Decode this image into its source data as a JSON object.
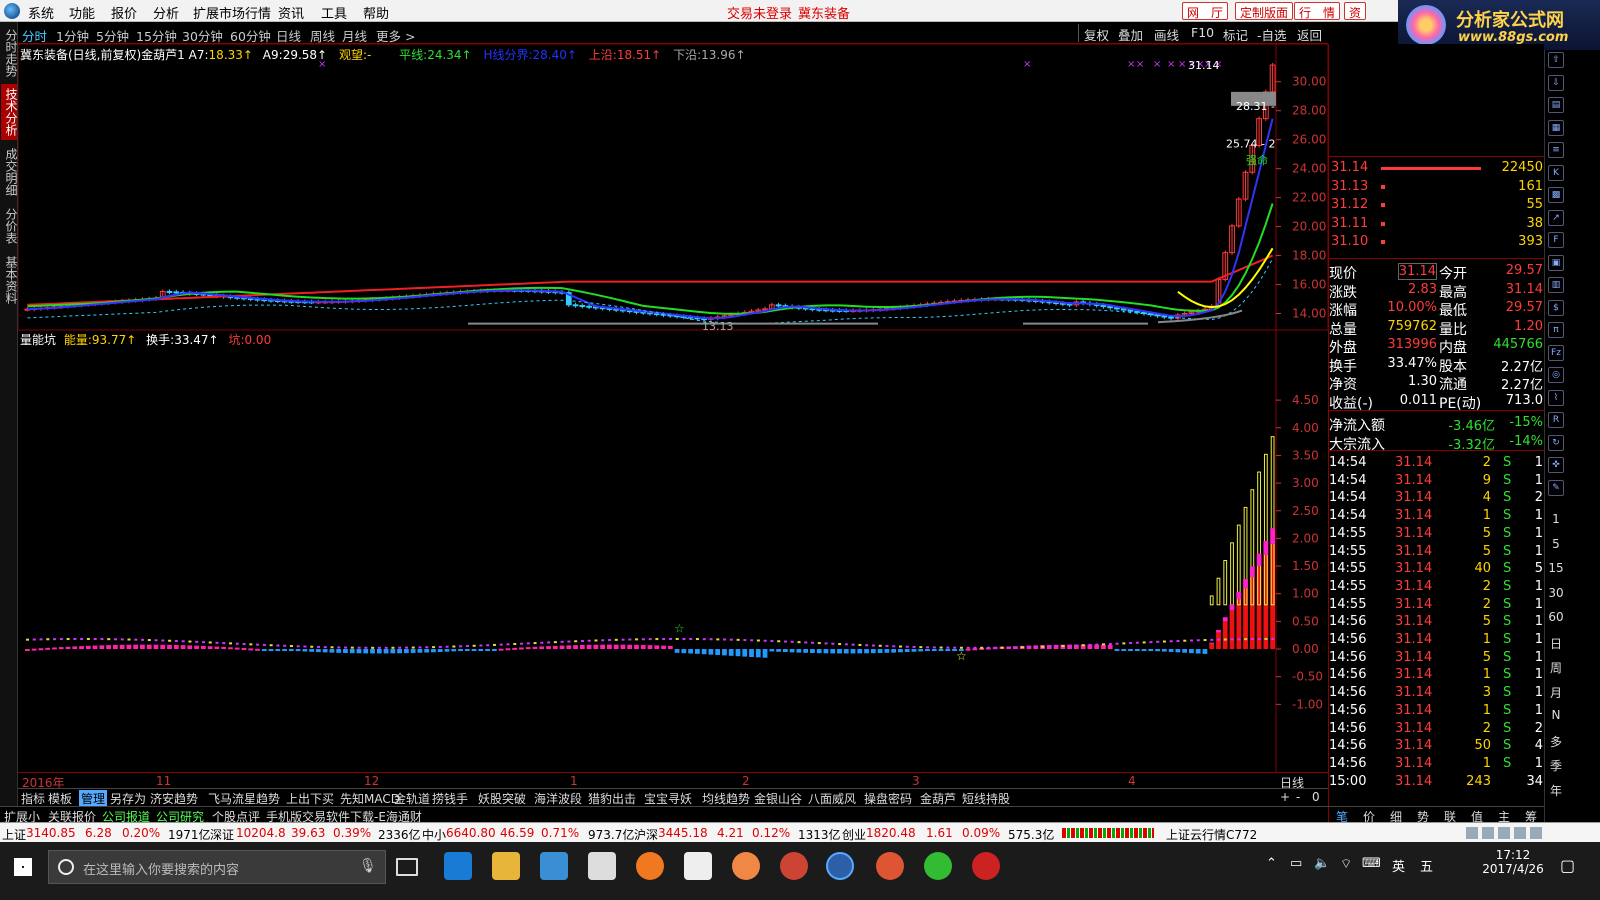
{
  "menubar": {
    "items": [
      "系统",
      "功能",
      "报价",
      "分析",
      "扩展市场行情",
      "资讯",
      "工具",
      "帮助"
    ],
    "login_status": "交易未登录",
    "stock_name": "冀东装备",
    "right_buttons": [
      "网　厅",
      "定制版面",
      "行　情",
      "资"
    ]
  },
  "brand": {
    "title": "分析家公式网",
    "url": "www.88gs.com"
  },
  "left_tabs": [
    "分时走势",
    "技术分析",
    "成交明细",
    "分价表",
    "基本资料"
  ],
  "period_bar": {
    "periods": [
      "分时",
      "1分钟",
      "5分钟",
      "15分钟",
      "30分钟",
      "60分钟",
      "日线",
      "周线",
      "月线",
      "更多 >"
    ],
    "tools": [
      "复权",
      "叠加",
      "画线",
      "F10",
      "标记",
      "-自选",
      "返回"
    ]
  },
  "main_chart": {
    "header": {
      "title": "冀东装备(日线,前复权)金葫芦1",
      "a7_label": "A7:",
      "a7_value": "18.33↑",
      "a9_label": "A9:",
      "a9_value": "29.58↑",
      "view_label": "观望:",
      "view_value": "-",
      "ping_label": "平线:",
      "ping_value": "24.34↑",
      "hong_label": "H线分界:",
      "hong_value": "28.40↑",
      "up_label": "上沿:",
      "up_value": "18.51↑",
      "down_label": "下沿:",
      "down_value": "13.96↑"
    },
    "annotations": {
      "high_price": "31.14",
      "level_2831": "28.31 -",
      "level_2574": "25.74 - 2",
      "strong_label": "强命",
      "low_price": "13.13"
    },
    "y_ticks": [
      "30.00",
      "28.00",
      "26.00",
      "24.00",
      "22.00",
      "20.00",
      "18.00",
      "16.00",
      "14.00"
    ]
  },
  "sub_chart": {
    "header": {
      "name": "量能坑",
      "energy_label": "能量:",
      "energy_value": "93.77↑",
      "turnover_label": "换手:",
      "turnover_value": "33.47↑",
      "pit_label": "坑:",
      "pit_value": "0.00"
    },
    "y_ticks": [
      "4.50",
      "4.00",
      "3.50",
      "3.00",
      "2.50",
      "2.00",
      "1.50",
      "1.00",
      "0.50",
      "0.00",
      "-0.50",
      "-1.00"
    ]
  },
  "date_axis": {
    "labels": [
      "2016年",
      "11",
      "12",
      "1",
      "2",
      "3",
      "4"
    ],
    "right_label": "日线"
  },
  "indicator_tabs": [
    "指标",
    "模板",
    "管理",
    "另存为",
    "济安趋势",
    "飞马流星趋势",
    "上出下买",
    "先知MACD",
    "金轨道",
    "捞钱手",
    "妖股突破",
    "海洋波段",
    "猎豹出击",
    "宝宝寻妖",
    "均线趋势",
    "金银山谷",
    "八面威风",
    "操盘密码",
    "金葫芦",
    "短线持股"
  ],
  "ext_tabs": [
    "扩展小",
    "关联报价",
    "公司报道",
    "公司研究",
    "个股点评",
    "手机版交易软件下载-E海通财"
  ],
  "zoom_controls": [
    "+",
    "-",
    "0"
  ],
  "order_book": [
    {
      "price": "31.14",
      "vol": "22450"
    },
    {
      "price": "31.13",
      "vol": "161"
    },
    {
      "price": "31.12",
      "vol": "55"
    },
    {
      "price": "31.11",
      "vol": "38"
    },
    {
      "price": "31.10",
      "vol": "393"
    }
  ],
  "quote": {
    "rows": [
      {
        "l1": "现价",
        "v1": "31.14",
        "l2": "今开",
        "v2": "29.57"
      },
      {
        "l1": "涨跌",
        "v1": "2.83",
        "l2": "最高",
        "v2": "31.14"
      },
      {
        "l1": "涨幅",
        "v1": "10.00%",
        "l2": "最低",
        "v2": "29.57"
      },
      {
        "l1": "总量",
        "v1": "759762",
        "l2": "量比",
        "v2": "1.20"
      },
      {
        "l1": "外盘",
        "v1": "313996",
        "l2": "内盘",
        "v2": "445766"
      },
      {
        "l1": "换手",
        "v1": "33.47%",
        "l2": "股本",
        "v2": "2.27亿"
      },
      {
        "l1": "净资",
        "v1": "1.30",
        "l2": "流通",
        "v2": "2.27亿"
      },
      {
        "l1": "收益(-)",
        "v1": "0.011",
        "l2": "PE(动)",
        "v2": "713.0"
      }
    ],
    "flow": [
      {
        "label": "净流入额",
        "value": "-3.46亿",
        "pct": "-15%"
      },
      {
        "label": "大宗流入",
        "value": "-3.32亿",
        "pct": "-14%"
      }
    ]
  },
  "ticks": [
    {
      "time": "14:54",
      "price": "31.14",
      "vol": "2",
      "side": "S",
      "n": "1"
    },
    {
      "time": "14:54",
      "price": "31.14",
      "vol": "9",
      "side": "S",
      "n": "1"
    },
    {
      "time": "14:54",
      "price": "31.14",
      "vol": "4",
      "side": "S",
      "n": "2"
    },
    {
      "time": "14:54",
      "price": "31.14",
      "vol": "1",
      "side": "S",
      "n": "1"
    },
    {
      "time": "14:55",
      "price": "31.14",
      "vol": "5",
      "side": "S",
      "n": "1"
    },
    {
      "time": "14:55",
      "price": "31.14",
      "vol": "5",
      "side": "S",
      "n": "1"
    },
    {
      "time": "14:55",
      "price": "31.14",
      "vol": "40",
      "side": "S",
      "n": "5"
    },
    {
      "time": "14:55",
      "price": "31.14",
      "vol": "2",
      "side": "S",
      "n": "1"
    },
    {
      "time": "14:55",
      "price": "31.14",
      "vol": "2",
      "side": "S",
      "n": "1"
    },
    {
      "time": "14:56",
      "price": "31.14",
      "vol": "5",
      "side": "S",
      "n": "1"
    },
    {
      "time": "14:56",
      "price": "31.14",
      "vol": "1",
      "side": "S",
      "n": "1"
    },
    {
      "time": "14:56",
      "price": "31.14",
      "vol": "5",
      "side": "S",
      "n": "1"
    },
    {
      "time": "14:56",
      "price": "31.14",
      "vol": "1",
      "side": "S",
      "n": "1"
    },
    {
      "time": "14:56",
      "price": "31.14",
      "vol": "3",
      "side": "S",
      "n": "1"
    },
    {
      "time": "14:56",
      "price": "31.14",
      "vol": "1",
      "side": "S",
      "n": "1"
    },
    {
      "time": "14:56",
      "price": "31.14",
      "vol": "2",
      "side": "S",
      "n": "2"
    },
    {
      "time": "14:56",
      "price": "31.14",
      "vol": "50",
      "side": "S",
      "n": "4"
    },
    {
      "time": "14:56",
      "price": "31.14",
      "vol": "1",
      "side": "S",
      "n": "1"
    },
    {
      "time": "15:00",
      "price": "31.14",
      "vol": "243",
      "side": "",
      "n": "34"
    }
  ],
  "right_bottom_tabs": [
    "笔",
    "价",
    "细",
    "势",
    "联",
    "值",
    "主",
    "筹"
  ],
  "right_toolbar_labels": [
    "1",
    "5",
    "15",
    "30",
    "60",
    "日",
    "周",
    "月",
    "N",
    "多",
    "季",
    "年"
  ],
  "status_bar": {
    "sh_label": "上证",
    "sh_value": "3140.85",
    "sh_chg": "6.28",
    "sh_pct": "0.20%",
    "sh_amt": "1971亿",
    "sz_label": "深证",
    "sz_value": "10204.8",
    "sz_chg": "39.63",
    "sz_pct": "0.39%",
    "sz_amt": "2336亿",
    "zx_label": "中小",
    "zx_value": "6640.80",
    "zx_chg": "46.59",
    "zx_pct": "0.71%",
    "zx_amt": "973.7亿",
    "hs_label": "沪深",
    "hs_value": "3445.18",
    "hs_chg": "4.21",
    "hs_pct": "0.12%",
    "hs_amt": "1313亿",
    "cy_label": "创业",
    "cy_value": "1820.48",
    "cy_chg": "1.61",
    "cy_pct": "0.09%",
    "cy_amt": "575.3亿",
    "cloud": "上证云行情C772"
  },
  "taskbar": {
    "search_placeholder": "在这里输入你要搜索的内容",
    "time": "17:12",
    "date": "2017/4/26",
    "ime1": "英",
    "ime2": "五"
  },
  "colors": {
    "up": "#ff3b3b",
    "down": "#2fe02f",
    "accent": "#3cf",
    "grid": "#800000"
  }
}
